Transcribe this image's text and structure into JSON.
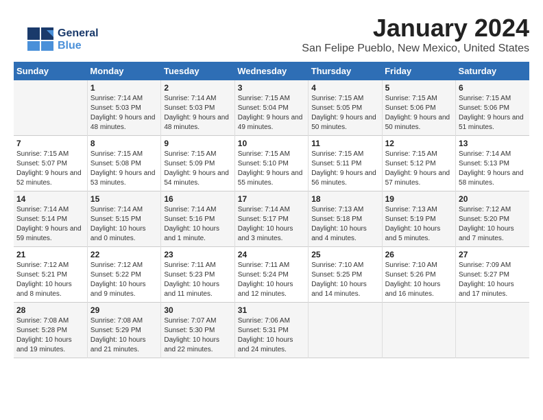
{
  "logo": {
    "general": "General",
    "blue": "Blue"
  },
  "header": {
    "month": "January 2024",
    "location": "San Felipe Pueblo, New Mexico, United States"
  },
  "days_of_week": [
    "Sunday",
    "Monday",
    "Tuesday",
    "Wednesday",
    "Thursday",
    "Friday",
    "Saturday"
  ],
  "weeks": [
    [
      {
        "day": "",
        "info": ""
      },
      {
        "day": "1",
        "info": "Sunrise: 7:14 AM\nSunset: 5:03 PM\nDaylight: 9 hours and 48 minutes."
      },
      {
        "day": "2",
        "info": "Sunrise: 7:14 AM\nSunset: 5:03 PM\nDaylight: 9 hours and 48 minutes."
      },
      {
        "day": "3",
        "info": "Sunrise: 7:15 AM\nSunset: 5:04 PM\nDaylight: 9 hours and 49 minutes."
      },
      {
        "day": "4",
        "info": "Sunrise: 7:15 AM\nSunset: 5:05 PM\nDaylight: 9 hours and 50 minutes."
      },
      {
        "day": "5",
        "info": "Sunrise: 7:15 AM\nSunset: 5:06 PM\nDaylight: 9 hours and 50 minutes."
      },
      {
        "day": "6",
        "info": "Sunrise: 7:15 AM\nSunset: 5:06 PM\nDaylight: 9 hours and 51 minutes."
      }
    ],
    [
      {
        "day": "7",
        "info": "Sunrise: 7:15 AM\nSunset: 5:07 PM\nDaylight: 9 hours and 52 minutes."
      },
      {
        "day": "8",
        "info": "Sunrise: 7:15 AM\nSunset: 5:08 PM\nDaylight: 9 hours and 53 minutes."
      },
      {
        "day": "9",
        "info": "Sunrise: 7:15 AM\nSunset: 5:09 PM\nDaylight: 9 hours and 54 minutes."
      },
      {
        "day": "10",
        "info": "Sunrise: 7:15 AM\nSunset: 5:10 PM\nDaylight: 9 hours and 55 minutes."
      },
      {
        "day": "11",
        "info": "Sunrise: 7:15 AM\nSunset: 5:11 PM\nDaylight: 9 hours and 56 minutes."
      },
      {
        "day": "12",
        "info": "Sunrise: 7:15 AM\nSunset: 5:12 PM\nDaylight: 9 hours and 57 minutes."
      },
      {
        "day": "13",
        "info": "Sunrise: 7:14 AM\nSunset: 5:13 PM\nDaylight: 9 hours and 58 minutes."
      }
    ],
    [
      {
        "day": "14",
        "info": "Sunrise: 7:14 AM\nSunset: 5:14 PM\nDaylight: 9 hours and 59 minutes."
      },
      {
        "day": "15",
        "info": "Sunrise: 7:14 AM\nSunset: 5:15 PM\nDaylight: 10 hours and 0 minutes."
      },
      {
        "day": "16",
        "info": "Sunrise: 7:14 AM\nSunset: 5:16 PM\nDaylight: 10 hours and 1 minute."
      },
      {
        "day": "17",
        "info": "Sunrise: 7:14 AM\nSunset: 5:17 PM\nDaylight: 10 hours and 3 minutes."
      },
      {
        "day": "18",
        "info": "Sunrise: 7:13 AM\nSunset: 5:18 PM\nDaylight: 10 hours and 4 minutes."
      },
      {
        "day": "19",
        "info": "Sunrise: 7:13 AM\nSunset: 5:19 PM\nDaylight: 10 hours and 5 minutes."
      },
      {
        "day": "20",
        "info": "Sunrise: 7:12 AM\nSunset: 5:20 PM\nDaylight: 10 hours and 7 minutes."
      }
    ],
    [
      {
        "day": "21",
        "info": "Sunrise: 7:12 AM\nSunset: 5:21 PM\nDaylight: 10 hours and 8 minutes."
      },
      {
        "day": "22",
        "info": "Sunrise: 7:12 AM\nSunset: 5:22 PM\nDaylight: 10 hours and 9 minutes."
      },
      {
        "day": "23",
        "info": "Sunrise: 7:11 AM\nSunset: 5:23 PM\nDaylight: 10 hours and 11 minutes."
      },
      {
        "day": "24",
        "info": "Sunrise: 7:11 AM\nSunset: 5:24 PM\nDaylight: 10 hours and 12 minutes."
      },
      {
        "day": "25",
        "info": "Sunrise: 7:10 AM\nSunset: 5:25 PM\nDaylight: 10 hours and 14 minutes."
      },
      {
        "day": "26",
        "info": "Sunrise: 7:10 AM\nSunset: 5:26 PM\nDaylight: 10 hours and 16 minutes."
      },
      {
        "day": "27",
        "info": "Sunrise: 7:09 AM\nSunset: 5:27 PM\nDaylight: 10 hours and 17 minutes."
      }
    ],
    [
      {
        "day": "28",
        "info": "Sunrise: 7:08 AM\nSunset: 5:28 PM\nDaylight: 10 hours and 19 minutes."
      },
      {
        "day": "29",
        "info": "Sunrise: 7:08 AM\nSunset: 5:29 PM\nDaylight: 10 hours and 21 minutes."
      },
      {
        "day": "30",
        "info": "Sunrise: 7:07 AM\nSunset: 5:30 PM\nDaylight: 10 hours and 22 minutes."
      },
      {
        "day": "31",
        "info": "Sunrise: 7:06 AM\nSunset: 5:31 PM\nDaylight: 10 hours and 24 minutes."
      },
      {
        "day": "",
        "info": ""
      },
      {
        "day": "",
        "info": ""
      },
      {
        "day": "",
        "info": ""
      }
    ]
  ]
}
